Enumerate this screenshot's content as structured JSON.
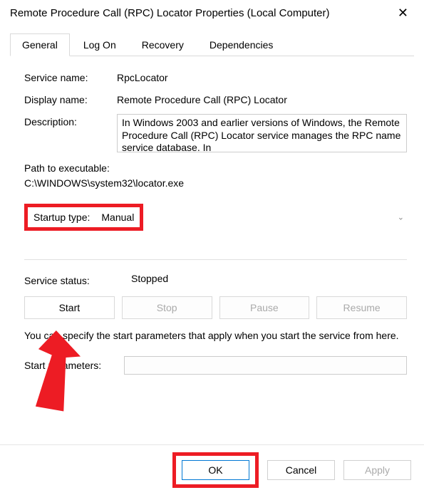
{
  "window": {
    "title": "Remote Procedure Call (RPC) Locator Properties (Local Computer)"
  },
  "tabs": {
    "general": "General",
    "logon": "Log On",
    "recovery": "Recovery",
    "dependencies": "Dependencies"
  },
  "labels": {
    "service_name": "Service name:",
    "display_name": "Display name:",
    "description": "Description:",
    "path_label": "Path to executable:",
    "startup_type": "Startup type:",
    "service_status": "Service status:",
    "start_params": "Start parameters:"
  },
  "values": {
    "service_name": "RpcLocator",
    "display_name": "Remote Procedure Call (RPC) Locator",
    "description": "In Windows 2003 and earlier versions of Windows, the Remote Procedure Call (RPC) Locator service manages the RPC name service database. In",
    "path": "C:\\WINDOWS\\system32\\locator.exe",
    "startup_type": "Manual",
    "service_status": "Stopped",
    "start_params": ""
  },
  "buttons": {
    "start": "Start",
    "stop": "Stop",
    "pause": "Pause",
    "resume": "Resume",
    "ok": "OK",
    "cancel": "Cancel",
    "apply": "Apply"
  },
  "hint": "You can specify the start parameters that apply when you start the service from here.",
  "highlight_color": "#ed1c24"
}
